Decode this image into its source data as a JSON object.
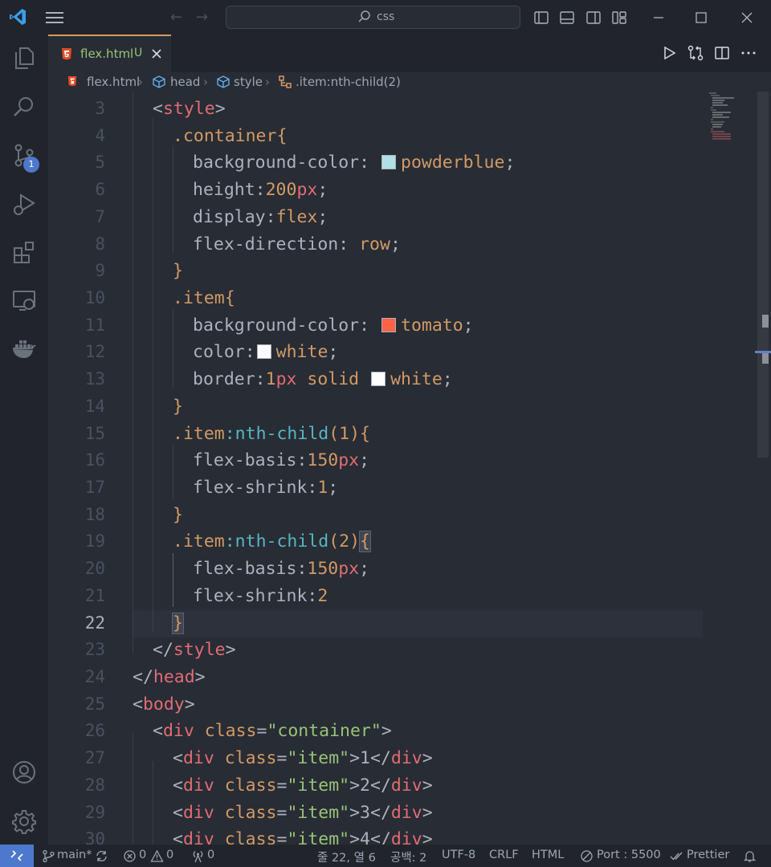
{
  "search": {
    "text": "css"
  },
  "tab": {
    "filename": "flex.html",
    "status": "U"
  },
  "breadcrumb": {
    "file": "flex.html",
    "head": "head",
    "style": "style",
    "selector": ".item:nth-child(2)"
  },
  "scm": {
    "badge": "1"
  },
  "editor": {
    "active_line": "22",
    "lines": [
      {
        "n": "3"
      },
      {
        "n": "4"
      },
      {
        "n": "5"
      },
      {
        "n": "6"
      },
      {
        "n": "7"
      },
      {
        "n": "8"
      },
      {
        "n": "9"
      },
      {
        "n": "10"
      },
      {
        "n": "11"
      },
      {
        "n": "12"
      },
      {
        "n": "13"
      },
      {
        "n": "14"
      },
      {
        "n": "15"
      },
      {
        "n": "16"
      },
      {
        "n": "17"
      },
      {
        "n": "18"
      },
      {
        "n": "19"
      },
      {
        "n": "20"
      },
      {
        "n": "21"
      },
      {
        "n": "22"
      },
      {
        "n": "23"
      },
      {
        "n": "24"
      },
      {
        "n": "25"
      },
      {
        "n": "26"
      },
      {
        "n": "27"
      },
      {
        "n": "28"
      },
      {
        "n": "29"
      },
      {
        "n": "30"
      }
    ],
    "code": {
      "l3": [
        "<",
        "style",
        ">"
      ],
      "l4": [
        ".container{"
      ],
      "l5": [
        "background-color: ",
        "powderblue",
        ";"
      ],
      "l6": [
        "height:",
        "200",
        "px",
        ";"
      ],
      "l7": [
        "display:",
        "flex",
        ";"
      ],
      "l8": [
        "flex-direction: ",
        "row",
        ";"
      ],
      "l9": [
        "}"
      ],
      "l10": [
        ".item{"
      ],
      "l11": [
        "background-color: ",
        "tomato",
        ";"
      ],
      "l12": [
        "color:",
        "white",
        ";"
      ],
      "l13": [
        "border:",
        "1",
        "px",
        " solid ",
        "white",
        ";"
      ],
      "l14": [
        "}"
      ],
      "l15": [
        ".item",
        ":nth-child",
        "(1){"
      ],
      "l16": [
        "flex-basis:",
        "150",
        "px",
        ";"
      ],
      "l17": [
        "flex-shrink:",
        "1",
        ";"
      ],
      "l18": [
        "}"
      ],
      "l19": [
        ".item",
        ":nth-child",
        "(2)",
        "{"
      ],
      "l20": [
        "flex-basis:",
        "150",
        "px",
        ";"
      ],
      "l21": [
        "flex-shrink:",
        "2"
      ],
      "l22": [
        "}"
      ],
      "l23": [
        "</",
        "style",
        ">"
      ],
      "l24": [
        "</",
        "head",
        ">"
      ],
      "l25": [
        "<",
        "body",
        ">"
      ],
      "l26": [
        "<",
        "div",
        " ",
        "class",
        "=",
        "\"container\"",
        ">"
      ],
      "l27": [
        "<",
        "div",
        " ",
        "class",
        "=",
        "\"item\"",
        ">1</",
        "div",
        ">"
      ],
      "l28": [
        "<",
        "div",
        " ",
        "class",
        "=",
        "\"item\"",
        ">2</",
        "div",
        ">"
      ],
      "l29": [
        "<",
        "div",
        " ",
        "class",
        "=",
        "\"item\"",
        ">3</",
        "div",
        ">"
      ],
      "l30": [
        "<",
        "div",
        " ",
        "class",
        "=",
        "\"item\"",
        ">4</",
        "div",
        ">"
      ]
    },
    "swatches": {
      "powderblue": "#b0e0e6",
      "tomato": "#ff6347",
      "white": "#ffffff"
    }
  },
  "status": {
    "branch": "main*",
    "errors": "0",
    "warnings": "0",
    "ports": "0",
    "position": "줄 22, 열 6",
    "indent": "공백: 2",
    "encoding": "UTF-8",
    "eol": "CRLF",
    "language": "HTML",
    "port": "Port : 5500",
    "formatter": "Prettier"
  },
  "colors": {
    "accent": "#4d78cc",
    "background": "#282c34",
    "chrome": "#21252b"
  }
}
